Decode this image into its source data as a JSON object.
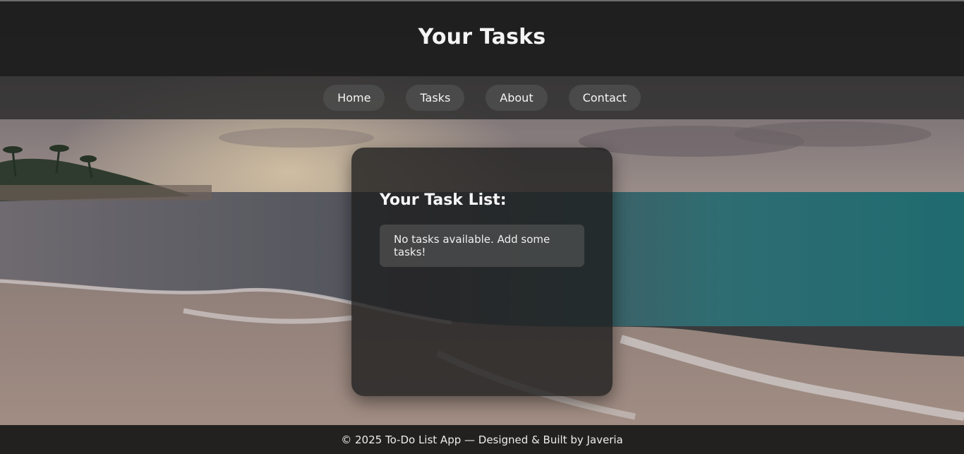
{
  "header": {
    "title": "Your Tasks"
  },
  "nav": {
    "items": [
      {
        "label": "Home"
      },
      {
        "label": "Tasks"
      },
      {
        "label": "About"
      },
      {
        "label": "Contact"
      }
    ]
  },
  "task_panel": {
    "heading": "Your Task List:",
    "empty_message": "No tasks available. Add some tasks!"
  },
  "footer": {
    "text": "© 2025 To-Do List App — Designed & Built by Javeria"
  },
  "colors": {
    "header_bg": "#1c1c1c",
    "nav_bg": "#303030",
    "pill_bg": "#4e4e4e",
    "card_bg": "#1e1e1e",
    "text": "#f4f4f4"
  }
}
